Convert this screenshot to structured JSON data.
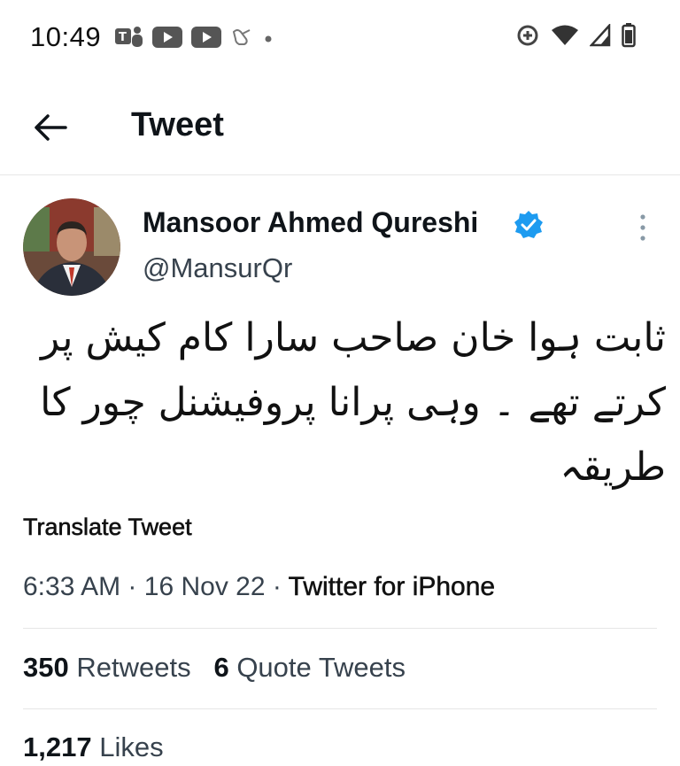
{
  "status_bar": {
    "time": "10:49",
    "notification_icons": [
      "teams-icon",
      "youtube-icon",
      "youtube-icon",
      "accessibility-icon",
      "dot-icon"
    ],
    "system_icons": [
      "data-saver-icon",
      "wifi-icon",
      "signal-icon",
      "battery-icon"
    ]
  },
  "header": {
    "back_icon": "arrow-left-icon",
    "title": "Tweet"
  },
  "tweet": {
    "author_name": "Mansoor Ahmed Qureshi",
    "author_handle": "@MansurQr",
    "verified": true,
    "text": "ثابت ہوا خان صاحب سارا کام کیش پر کرتے تھے ۔ وہی پرانا پروفیشنل چور کا طریقہ",
    "translate_label": "Translate Tweet",
    "time": "6:33 AM",
    "date": "16 Nov 22",
    "separator": "·",
    "source": "Twitter for iPhone"
  },
  "stats": {
    "retweets_count": "350",
    "retweets_label": "Retweets",
    "quotes_count": "6",
    "quotes_label": "Quote Tweets",
    "likes_count": "1,217",
    "likes_label": "Likes"
  },
  "colors": {
    "verified_blue": "#1d9bf0",
    "text_primary": "#0f1419",
    "text_secondary": "#37424d",
    "divider": "#e6e6e6"
  }
}
